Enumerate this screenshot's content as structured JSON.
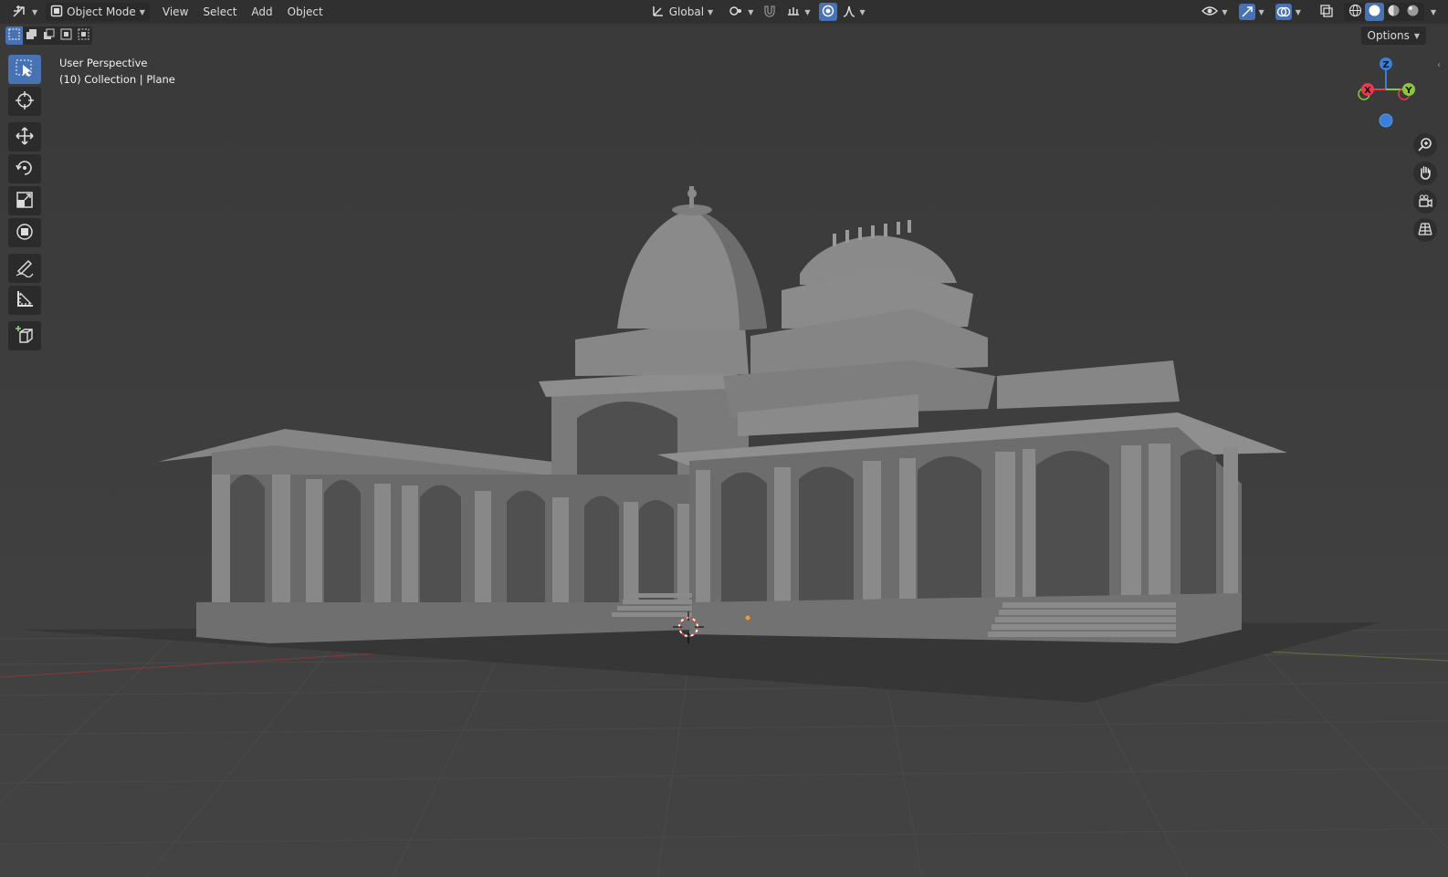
{
  "header": {
    "editor_type_icon": "orientation-axes-icon",
    "mode": {
      "label": "Object Mode",
      "icon": "object-mode-cube-icon"
    },
    "menus": [
      "View",
      "Select",
      "Add",
      "Object"
    ],
    "transform_orientation": {
      "label": "Global",
      "icon": "transform-orientation-icon"
    },
    "pivot_icon": "pivot-point-icon",
    "snap_icon": "magnet-snap-icon",
    "snap_target_icon": "snap-increment-icon",
    "proportional_edit_icon": "proportional-edit-icon",
    "falloff_icon": "falloff-curve-icon",
    "right_icons": [
      "visibility-eye-icon",
      "gizmo-toggle-icon",
      "overlay-toggle-icon",
      "xray-toggle-icon",
      "wireframe-shading-icon",
      "solid-shading-icon",
      "material-preview-icon",
      "rendered-shading-icon"
    ]
  },
  "selection_modes": [
    "select-new-icon",
    "select-extend-icon",
    "select-subtract-icon",
    "select-invert-icon",
    "select-intersect-icon"
  ],
  "options_label": "Options",
  "viewport": {
    "view_name": "User Perspective",
    "collection_info": "(10) Collection | Plane"
  },
  "toolbar": [
    {
      "name": "select-box-tool",
      "icon": "select-box-icon",
      "active": true
    },
    {
      "name": "cursor-tool",
      "icon": "cursor-icon",
      "active": false
    },
    {
      "name": "move-tool",
      "icon": "move-arrows-icon",
      "active": false
    },
    {
      "name": "rotate-tool",
      "icon": "rotate-icon",
      "active": false
    },
    {
      "name": "scale-tool",
      "icon": "scale-icon",
      "active": false
    },
    {
      "name": "transform-tool",
      "icon": "transform-icon",
      "active": false
    },
    {
      "name": "annotate-tool",
      "icon": "annotate-pencil-icon",
      "active": false
    },
    {
      "name": "measure-tool",
      "icon": "measure-ruler-icon",
      "active": false
    },
    {
      "name": "add-cube-tool",
      "icon": "add-cube-icon",
      "active": false
    }
  ],
  "gizmo": {
    "z_label": "Z",
    "y_label": "Y",
    "x_label": "X",
    "colors": {
      "x": "#e63b50",
      "y": "#8cc63e",
      "z": "#3a7fd9"
    }
  },
  "nav_buttons": [
    "zoom-magnifier-icon",
    "pan-hand-icon",
    "camera-view-icon",
    "ortho-grid-icon"
  ],
  "colors": {
    "background": "#3d3d3d",
    "header": "#303030",
    "accent": "#4772b3",
    "model": "#7e7e7e"
  }
}
